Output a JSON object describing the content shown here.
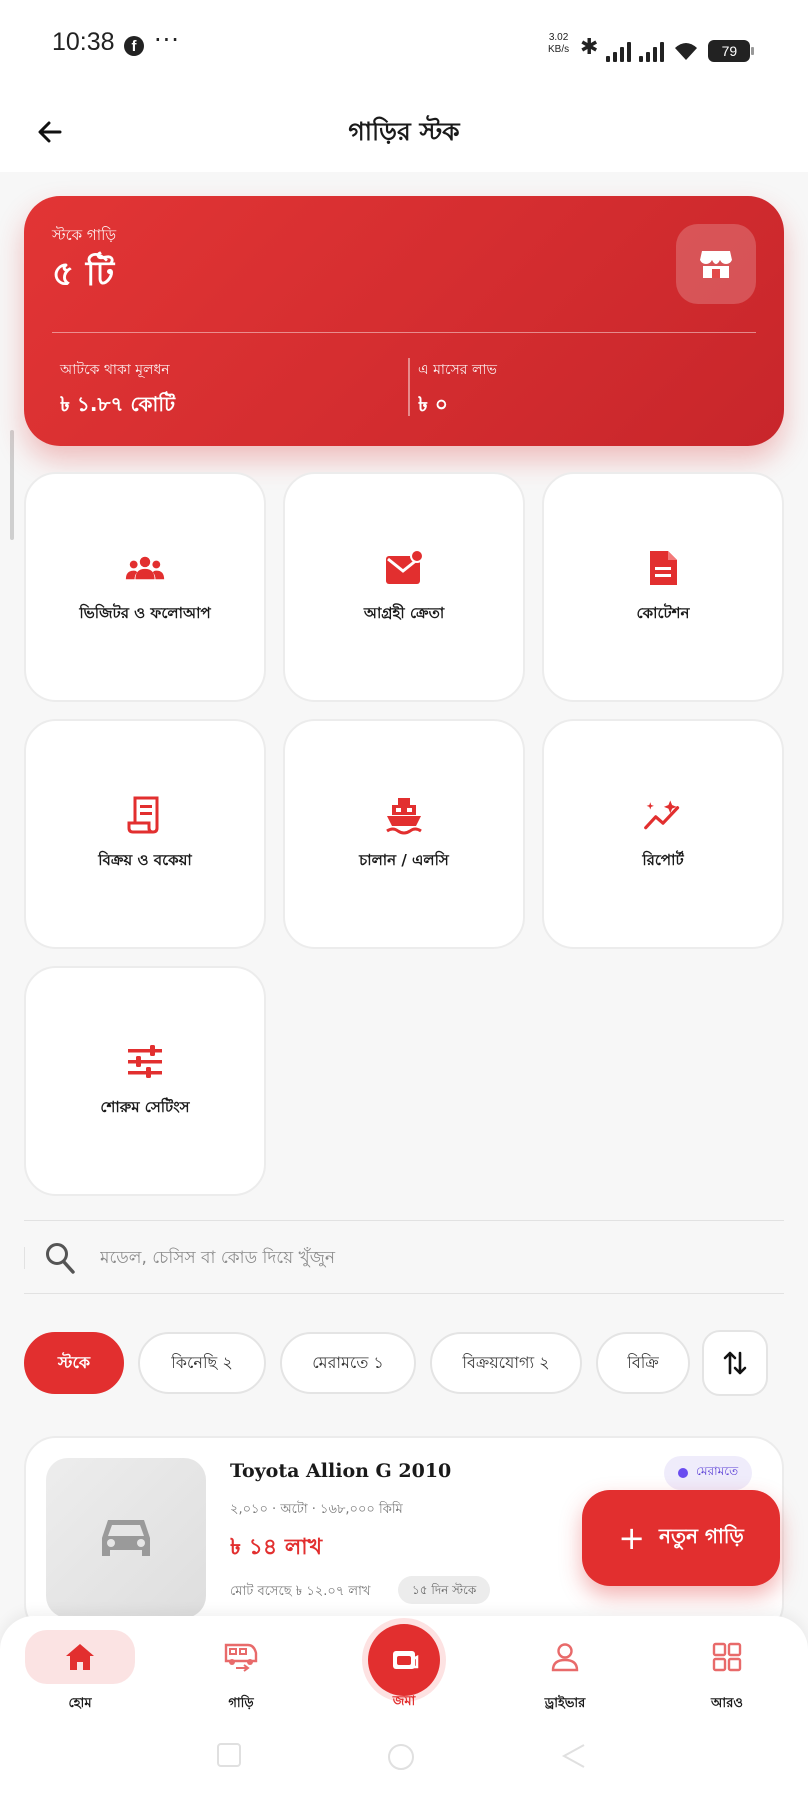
{
  "status_bar": {
    "time": "10:38",
    "fb_glyph": "f",
    "more": "···",
    "speed_value": "3.02",
    "speed_unit": "KB/s",
    "battery": "79"
  },
  "app_bar": {
    "title": "গাড়ির স্টক",
    "back_icon": "arrow-left-icon"
  },
  "summary": {
    "stock_label": "স্টকে গাড়ি",
    "stock_value": "৫ টি",
    "capital_label": "আটকে থাকা মূলধন",
    "capital_value": "৳ ১.৮৭ কোটি",
    "profit_label": "এ মাসের লাভ",
    "profit_value": "৳ ০",
    "badge_icon": "storefront-icon"
  },
  "tiles": [
    {
      "label": "ভিজিটর ও ফলোআপ",
      "icon": "group-icon"
    },
    {
      "label": "আগ্রহী ক্রেতা",
      "icon": "mail-notification-icon"
    },
    {
      "label": "কোটেশন",
      "icon": "document-icon"
    },
    {
      "label": "বিক্রয় ও বকেয়া",
      "icon": "receipt-icon"
    },
    {
      "label": "চালান / এলসি",
      "icon": "ship-icon"
    },
    {
      "label": "রিপোর্ট",
      "icon": "trend-sparkle-icon"
    },
    {
      "label": "শোরুম সেটিংস",
      "icon": "sliders-icon"
    }
  ],
  "search": {
    "placeholder": "মডেল, চেসিস বা কোড দিয়ে খুঁজুন"
  },
  "filters": [
    {
      "label": "স্টকে",
      "active": true
    },
    {
      "label": "কিনেছি ২",
      "active": false
    },
    {
      "label": "মেরামতে ১",
      "active": false
    },
    {
      "label": "বিক্রয়যোগ্য ২",
      "active": false
    },
    {
      "label": "বিক্রি",
      "active": false
    }
  ],
  "car": {
    "name": "Toyota Allion G 2010",
    "meta": "২,০১০ · অটো · ১৬৮,০০০ কিমি",
    "price": "৳ ১৪ লাখ",
    "cost": "মোট বসেছে ৳ ১২.০৭ লাখ",
    "days": "১৫ দিন স্টকে",
    "status": "মেরামতে",
    "status_color": "#6a4cf0"
  },
  "fab": {
    "label": "নতুন গাড়ি"
  },
  "bottom_nav": {
    "home": "হোম",
    "cars": "গাড়ি",
    "deposit": "জমা",
    "driver": "ড্রাইভার",
    "more": "আরও"
  },
  "colors": {
    "accent": "#e22f2f",
    "accent_light": "#fbe3e3"
  }
}
